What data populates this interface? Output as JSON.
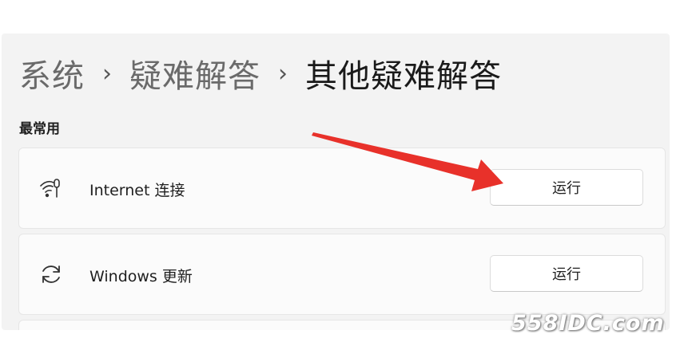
{
  "breadcrumb": {
    "items": [
      "系统",
      "疑难解答",
      "其他疑难解答"
    ],
    "separator": "›"
  },
  "section": {
    "title": "最常用"
  },
  "troubleshooters": [
    {
      "icon": "wifi-icon",
      "label": "Internet 连接",
      "button": "运行"
    },
    {
      "icon": "sync-icon",
      "label": "Windows 更新",
      "button": "运行"
    }
  ],
  "annotation": {
    "arrow_color": "#e8312a"
  },
  "watermark": {
    "text": "558IDC.com"
  }
}
